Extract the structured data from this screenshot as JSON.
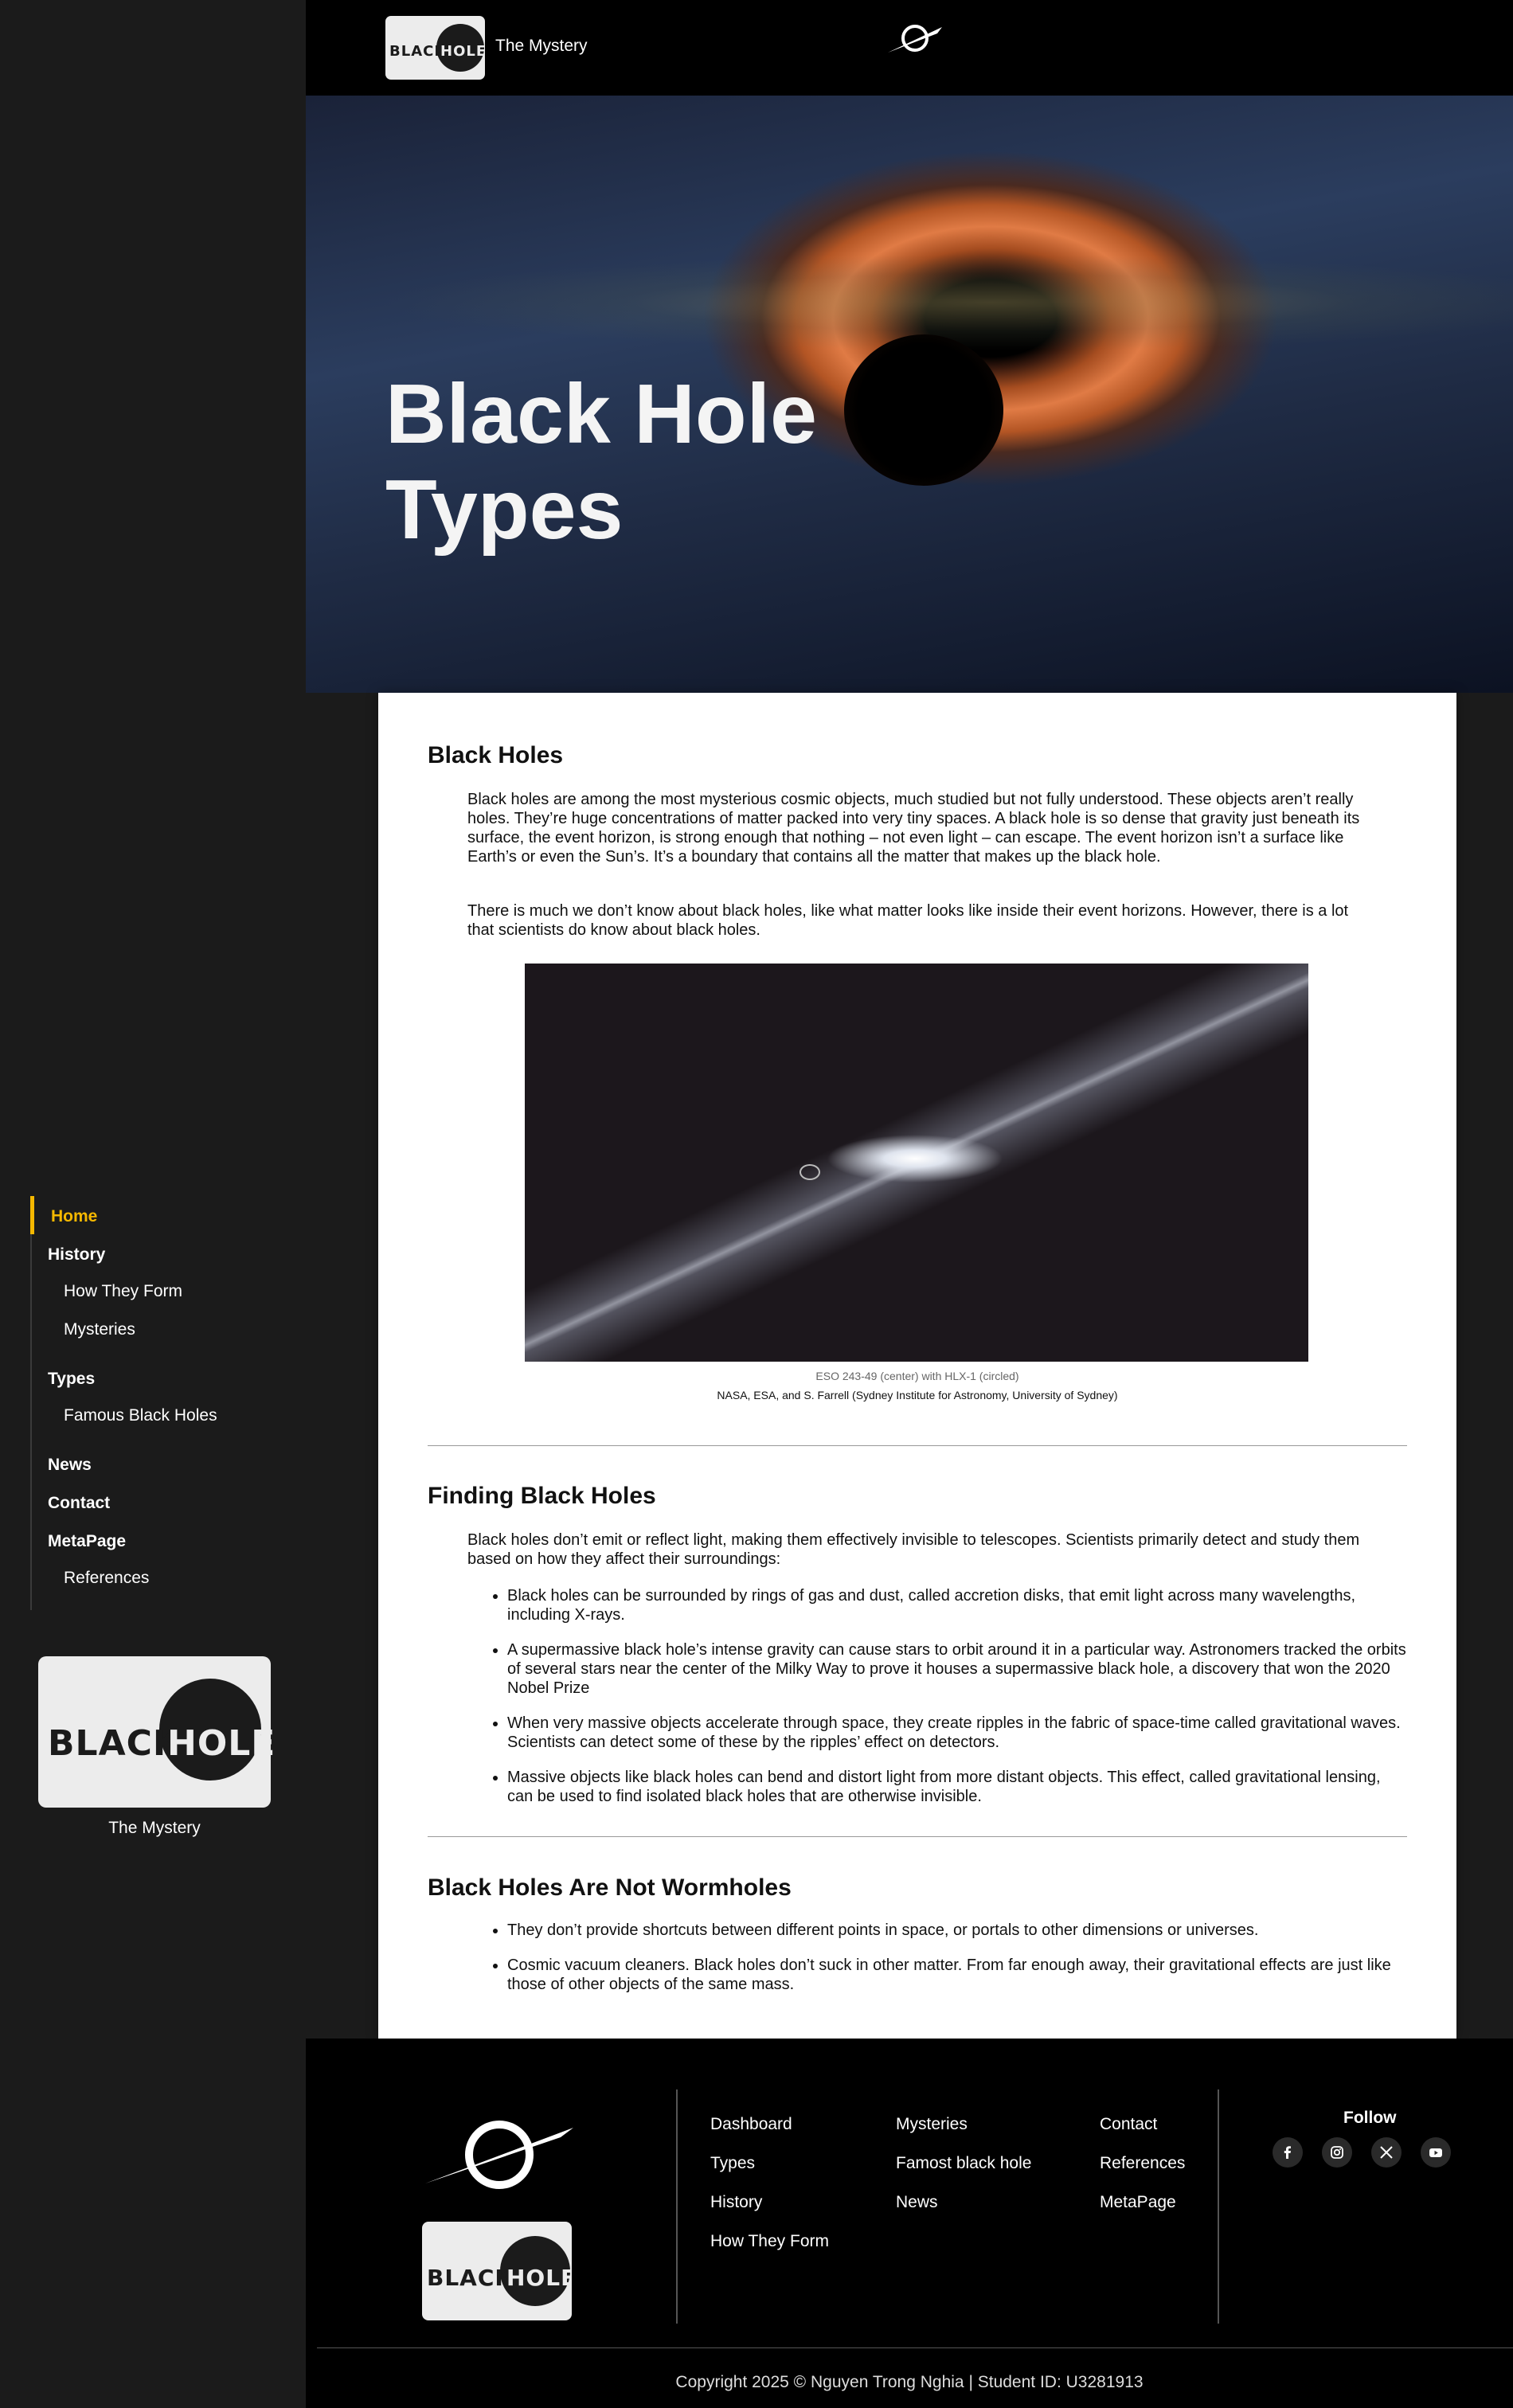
{
  "site": {
    "title": "The Mystery",
    "logo_word1": "BLACK",
    "logo_word2": "HOLE"
  },
  "sidebar": {
    "items": [
      {
        "label": "Home"
      },
      {
        "label": "History"
      },
      {
        "label": "How They Form"
      },
      {
        "label": "Mysteries"
      },
      {
        "label": "Types"
      },
      {
        "label": "Famous Black Holes"
      },
      {
        "label": "News"
      },
      {
        "label": "Contact"
      },
      {
        "label": "MetaPage"
      },
      {
        "label": "References"
      }
    ],
    "tagline": "The Mystery"
  },
  "hero": {
    "line1": "Black Hole",
    "line2": "Types"
  },
  "article": {
    "s1_title": "Black Holes",
    "s1_p1": "Black holes are among the most mysterious cosmic objects, much studied but not fully understood. These objects aren’t really holes. They’re huge concentrations of matter packed into very tiny spaces. A black hole is so dense that gravity just beneath its surface, the event horizon, is strong enough that nothing – not even light – can escape. The event horizon isn’t a surface like Earth’s or even the Sun’s. It’s a boundary that contains all the matter that makes up the black hole.",
    "s1_p2": "There is much we don’t know about black holes, like what matter looks like inside their event horizons. However, there is a lot that scientists do know about black holes.",
    "caption": "ESO 243-49 (center) with HLX-1 (circled)",
    "credit": "NASA, ESA, and S. Farrell (Sydney Institute for Astronomy, University of Sydney)",
    "s2_title": "Finding Black Holes",
    "s2_intro": "Black holes don’t emit or reflect light, making them effectively invisible to telescopes. Scientists primarily detect and study them based on how they affect their surroundings:",
    "s2_bullets": [
      "Black holes can be surrounded by rings of gas and dust, called accretion disks, that emit light across many wavelengths, including X-rays.",
      "A supermassive black hole’s intense gravity can cause stars to orbit around it in a particular way. Astronomers tracked the orbits of several stars near the center of the Milky Way to prove it houses a supermassive black hole, a discovery that won the 2020 Nobel Prize",
      "When very massive objects accelerate through space, they create ripples in the fabric of space-time called gravitational waves. Scientists can detect some of these by the ripples’ effect on detectors.",
      "Massive objects like black holes can bend and distort light from more distant objects. This effect, called gravitational lensing, can be used to find isolated black holes that are otherwise invisible."
    ],
    "s3_title": "Black Holes Are Not Wormholes",
    "s3_bullets": [
      "They don’t provide shortcuts between different points in space, or portals to other dimensions or universes.",
      "Cosmic vacuum cleaners. Black holes don’t suck in other matter. From far enough away, their gravitational effects are just like those of other objects of the same mass."
    ]
  },
  "footer": {
    "col1": [
      "Dashboard",
      "Types",
      "History",
      "How They Form"
    ],
    "col2": [
      "Mysteries",
      "Famost black hole",
      "News"
    ],
    "col3": [
      "Contact",
      "References",
      "MetaPage"
    ],
    "follow": "Follow",
    "social": [
      "facebook-icon",
      "instagram-icon",
      "x-icon",
      "youtube-icon"
    ],
    "copyright": "Copyright 2025 © Nguyen Trong Nghia | Student ID: U3281913"
  },
  "colors": {
    "accent": "#f5b800",
    "sidebar_bg": "#1b1b1b",
    "footer_bg": "#000000"
  }
}
